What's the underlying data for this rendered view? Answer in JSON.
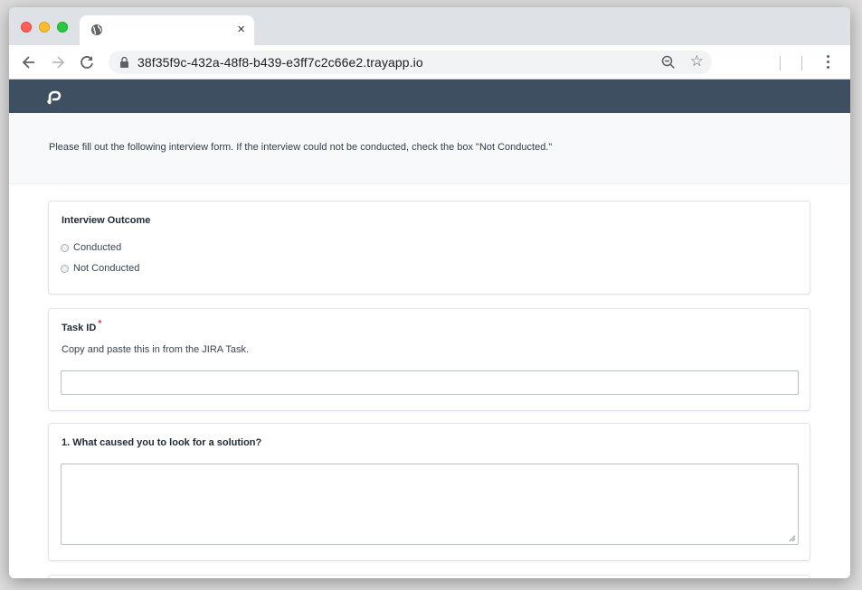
{
  "browser": {
    "tab": {
      "title": "",
      "close_glyph": "×"
    },
    "url": "38f35f9c-432a-48f8-b439-e3ff7c2c66e2.trayapp.io"
  },
  "page": {
    "intro_text": "Please fill out the following interview form. If the interview could not be conducted, check the box \"Not Conducted.\"",
    "outcome": {
      "title": "Interview Outcome",
      "options": [
        "Conducted",
        "Not Conducted"
      ]
    },
    "task_id": {
      "title": "Task ID",
      "required_mark": "*",
      "helper": "Copy and paste this in from the JIRA Task.",
      "value": ""
    },
    "question1": {
      "title": "1. What caused you to look for a solution?",
      "value": ""
    }
  },
  "colors": {
    "header_bg": "#3e4f62",
    "required": "#e0334a"
  }
}
